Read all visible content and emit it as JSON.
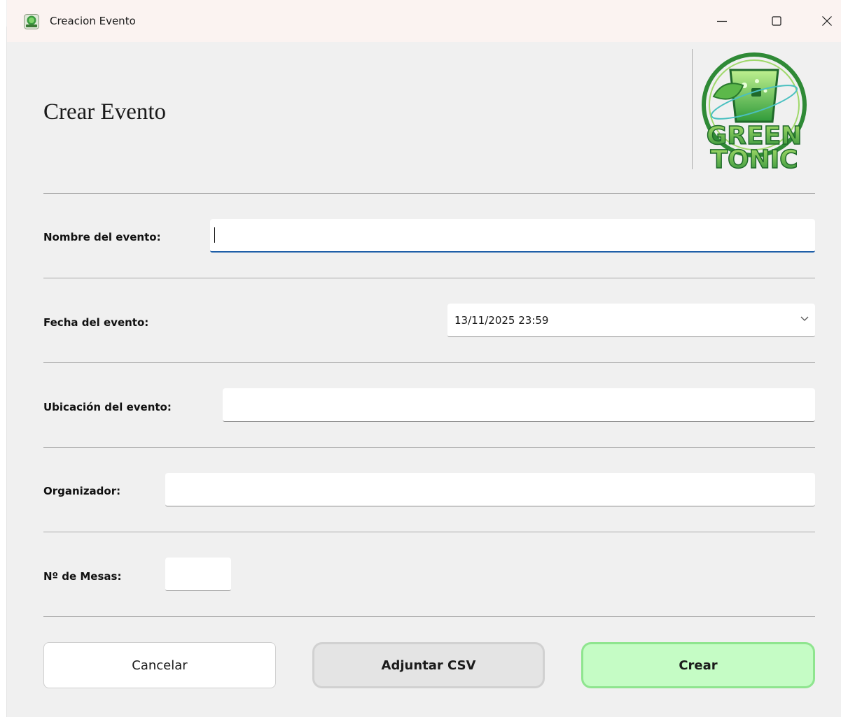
{
  "window": {
    "title": "Creacion Evento",
    "controls": [
      "minimize",
      "maximize",
      "close"
    ]
  },
  "page": {
    "heading": "Crear Evento",
    "logo": {
      "line1": "GREEN",
      "line2": "TONIC",
      "colors": [
        "#2e8b3a",
        "#5cc45f",
        "#b6e36b"
      ]
    }
  },
  "form": {
    "name": {
      "label": "Nombre del evento:",
      "value": "",
      "focused": true
    },
    "date": {
      "label": "Fecha del evento:",
      "value": "13/11/2025 23:59"
    },
    "location": {
      "label": "Ubicación del evento:",
      "value": ""
    },
    "organizer": {
      "label": "Organizador:",
      "value": ""
    },
    "tables": {
      "label": "Nº de Mesas:",
      "value": ""
    }
  },
  "buttons": {
    "cancel": "Cancelar",
    "attach": "Adjuntar CSV",
    "create": "Crear"
  },
  "colors": {
    "create_bg": "#c5fcc5",
    "create_border": "#8fe58f",
    "focus_underline": "#1f5fa8"
  }
}
